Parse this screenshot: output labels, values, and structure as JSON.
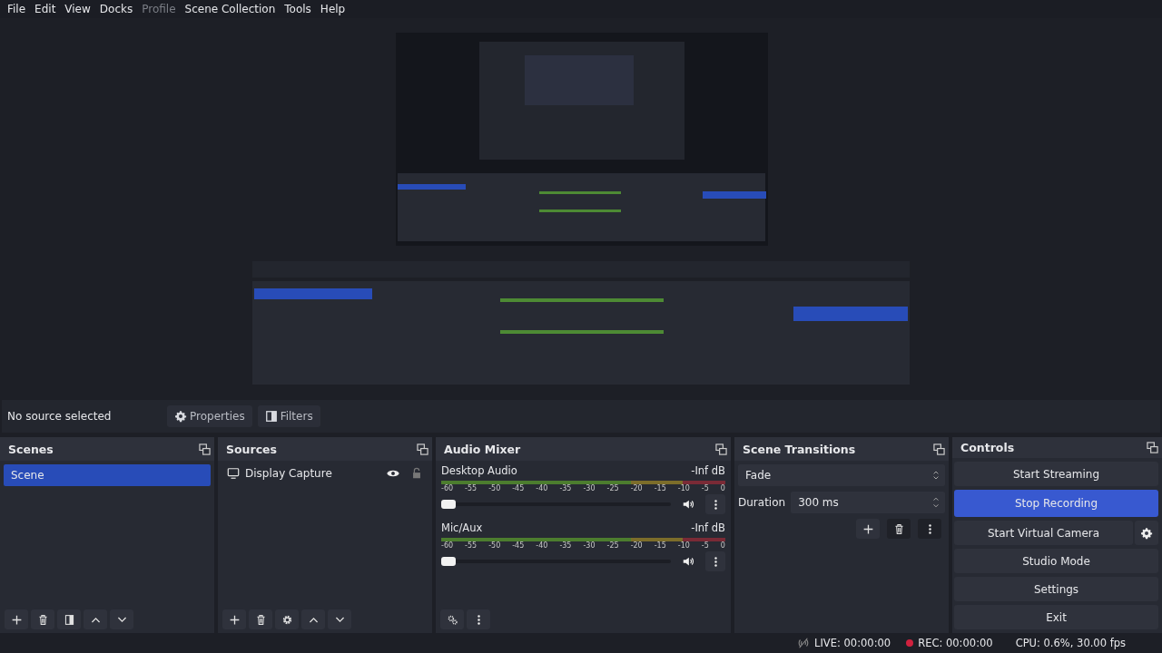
{
  "menu": [
    {
      "label": "File",
      "disabled": false
    },
    {
      "label": "Edit",
      "disabled": false
    },
    {
      "label": "View",
      "disabled": false
    },
    {
      "label": "Docks",
      "disabled": false
    },
    {
      "label": "Profile",
      "disabled": true
    },
    {
      "label": "Scene Collection",
      "disabled": false
    },
    {
      "label": "Tools",
      "disabled": false
    },
    {
      "label": "Help",
      "disabled": false
    }
  ],
  "source_toolbar": {
    "status": "No source selected",
    "buttons": [
      "Properties",
      "Filters"
    ]
  },
  "scenes": {
    "title": "Scenes",
    "items": [
      {
        "label": "Scene",
        "selected": true
      }
    ]
  },
  "sources": {
    "title": "Sources",
    "items": [
      {
        "label": "Display Capture",
        "visible": true,
        "locked": false
      }
    ]
  },
  "audio_mixer": {
    "title": "Audio Mixer",
    "channels": [
      {
        "name": "Desktop Audio",
        "reading": "-Inf dB",
        "level": 0.0,
        "muted": false,
        "scale": [
          "-60",
          "-55",
          "-50",
          "-45",
          "-40",
          "-35",
          "-30",
          "-25",
          "-20",
          "-15",
          "-10",
          "-5",
          "0"
        ]
      },
      {
        "name": "Mic/Aux",
        "reading": "-Inf dB",
        "level": 0.0,
        "muted": false,
        "scale": [
          "-60",
          "-55",
          "-50",
          "-45",
          "-40",
          "-35",
          "-30",
          "-25",
          "-20",
          "-15",
          "-10",
          "-5",
          "0"
        ]
      }
    ]
  },
  "scene_transitions": {
    "title": "Scene Transitions",
    "transition": "Fade",
    "duration_label": "Duration",
    "duration": "300 ms"
  },
  "controls": {
    "title": "Controls",
    "buttons": [
      {
        "label": "Start Streaming",
        "selected": false,
        "has_settings": false
      },
      {
        "label": "Stop Recording",
        "selected": true,
        "has_settings": false
      },
      {
        "label": "Start Virtual Camera",
        "selected": false,
        "has_settings": true
      },
      {
        "label": "Studio Mode",
        "selected": false,
        "has_settings": false
      },
      {
        "label": "Settings",
        "selected": false,
        "has_settings": false
      },
      {
        "label": "Exit",
        "selected": false,
        "has_settings": false
      }
    ]
  },
  "status_bar": {
    "live": "LIVE: 00:00:00",
    "rec": "REC: 00:00:00",
    "cpu": "CPU: 0.6%, 30.00 fps"
  }
}
